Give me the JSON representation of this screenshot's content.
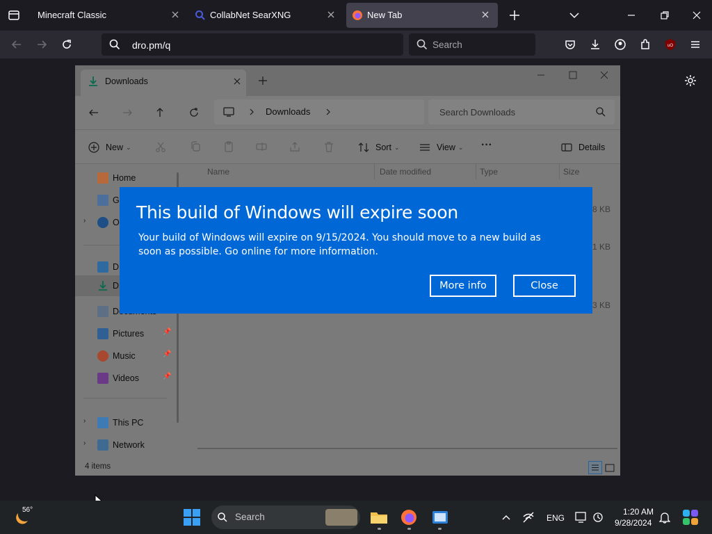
{
  "browser": {
    "tabs": [
      {
        "label": "Minecraft Classic"
      },
      {
        "label": "CollabNet SearXNG"
      },
      {
        "label": "New Tab"
      }
    ],
    "url": "dro.pm/q",
    "search_placeholder": "Search"
  },
  "explorer": {
    "tab_title": "Downloads",
    "breadcrumb": "Downloads",
    "search_placeholder": "Search Downloads",
    "commands": {
      "new": "New",
      "sort": "Sort",
      "view": "View",
      "details": "Details"
    },
    "columns": {
      "name": "Name",
      "date": "Date modified",
      "type": "Type",
      "size": "Size"
    },
    "sidebar": [
      {
        "label": "Home"
      },
      {
        "label": "G"
      },
      {
        "label": "O"
      },
      {
        "label": "D"
      },
      {
        "label": "D"
      },
      {
        "label": "Documents"
      },
      {
        "label": "Pictures"
      },
      {
        "label": "Music"
      },
      {
        "label": "Videos"
      },
      {
        "label": "This PC"
      },
      {
        "label": "Network"
      }
    ],
    "sizes": [
      "8 KB",
      "1 KB",
      "3 KB"
    ],
    "status": "4 items"
  },
  "dialog": {
    "title": "This build of Windows will expire soon",
    "message": "Your build of Windows will expire on 9/15/2024. You should move to a new build as soon as possible. Go online for more information.",
    "more_info": "More info",
    "close": "Close"
  },
  "taskbar": {
    "weather": "56°",
    "search_placeholder": "Search",
    "lang": "ENG",
    "time": "1:20 AM",
    "date": "9/28/2024"
  },
  "colors": {
    "dialog_bg": "#0067d6",
    "browser_bg": "#1c1b22",
    "taskbar_bg": "#1f2326"
  }
}
